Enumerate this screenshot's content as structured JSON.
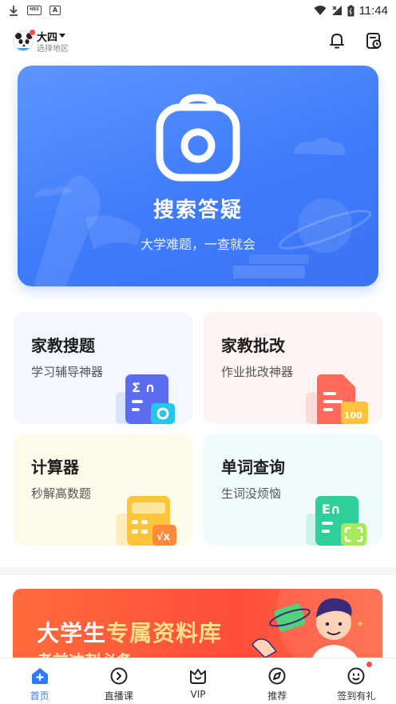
{
  "status_bar": {
    "time": "11:44",
    "badge_a": "A",
    "badge_hrs": "HRS"
  },
  "header": {
    "location_title": "大四",
    "location_sub": "选择地区"
  },
  "banner": {
    "title": "搜索答疑",
    "subtitle": "大学难题，一查就会"
  },
  "tools": [
    {
      "title": "家教搜题",
      "subtitle": "学习辅导神器"
    },
    {
      "title": "家教批改",
      "subtitle": "作业批改神器",
      "badge": "100"
    },
    {
      "title": "计算器",
      "subtitle": "秒解高数题"
    },
    {
      "title": "单词查询",
      "subtitle": "生词没烦恼"
    }
  ],
  "promo": {
    "title_plain": "大学生",
    "title_highlight": "专属资料库",
    "subtitle": "考前冲刺必备"
  },
  "bottom_nav": [
    {
      "label": "首页",
      "active": true
    },
    {
      "label": "直播课",
      "active": false
    },
    {
      "label": "VIP",
      "active": false
    },
    {
      "label": "推荐",
      "active": false
    },
    {
      "label": "签到有礼",
      "active": false
    }
  ],
  "colors": {
    "accent": "#2f7bff",
    "banner": "#3f7cfb",
    "promo": "#ff4d3a",
    "badge_dot": "#ff4b3a"
  }
}
